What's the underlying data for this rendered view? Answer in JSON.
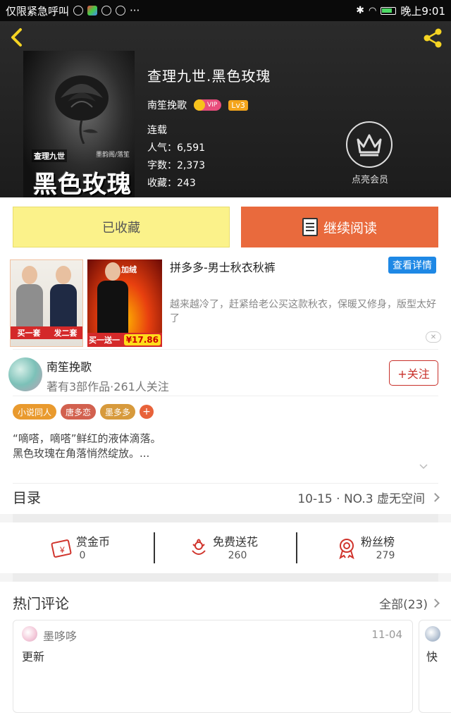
{
  "status_bar": {
    "carrier_text": "仅限紧急呼叫",
    "more_indicator": "···",
    "time": "晚上9:01"
  },
  "book": {
    "title": "查理九世.黑色玫瑰",
    "author": "南笙挽歌",
    "vip_label": "VIP",
    "level": "Lv3",
    "status": "连载",
    "popularity": "人气：6,591",
    "word_count": "字数：2,373",
    "favorites": "收藏：243",
    "cover": {
      "small_title": "查理九世",
      "author_credit": "墨韵阁/落笙",
      "big_title": "黑色玫瑰"
    }
  },
  "membership": {
    "label": "点亮会员"
  },
  "actions": {
    "favorited_label": "已收藏",
    "continue_label": "继续阅读"
  },
  "ad": {
    "title": "拼多多-男士秋衣秋裤",
    "detail_label": "查看详情",
    "description": "越来越冷了，赶紧给老公买这款秋衣，保暖又修身，版型太好了",
    "img1_tag_left": "买一套",
    "img1_tag_right": "发二套",
    "img2_badge": "加绒",
    "img2_tag": "买一送一",
    "img2_price": "¥17.86",
    "close_label": "✕"
  },
  "author_section": {
    "name": "南笙挽歌",
    "stats": "著有3部作品·261人关注",
    "follow_label": "+关注",
    "tags": [
      {
        "label": "小说同人",
        "color": "#e99a2e"
      },
      {
        "label": "唐多恋",
        "color": "#d2614f"
      },
      {
        "label": "墨多多",
        "color": "#d79a3c"
      }
    ],
    "tag_add": "+",
    "intro_line1": "“嘀嗒，嘀嗒”鲜红的液体滴落。",
    "intro_line2": "黑色玫瑰在角落悄然绽放。..."
  },
  "toc": {
    "label": "目录",
    "latest": "10-15 · NO.3  虚无空间"
  },
  "rewards": [
    {
      "label": "赏金币",
      "value": "0",
      "icon": "coupon-icon",
      "color": "#d0342c"
    },
    {
      "label": "免费送花",
      "value": "260",
      "icon": "flower-icon",
      "color": "#d0342c"
    },
    {
      "label": "粉丝榜",
      "value": "279",
      "icon": "medal-icon",
      "color": "#d0342c"
    }
  ],
  "hot_comments": {
    "title": "热门评论",
    "all_label": "全部(23)",
    "items": [
      {
        "user": "墨哆哆",
        "date": "11-04",
        "text": "更新"
      },
      {
        "user": "",
        "date": "",
        "text": "快"
      }
    ]
  },
  "colors": {
    "accent_yellow": "#f5d423",
    "read_button": "#e96a3d",
    "favorite_button": "#fbf28a",
    "follow": "#c8302a",
    "ad_blue": "#1e88e5"
  }
}
